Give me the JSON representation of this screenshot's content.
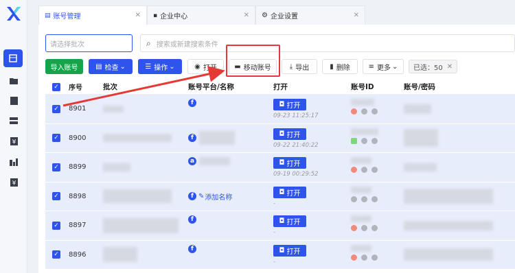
{
  "tabs": [
    {
      "label": "账号管理",
      "icon": "table-icon",
      "active": true
    },
    {
      "label": "企业中心",
      "icon": "briefcase-icon",
      "active": false
    },
    {
      "label": "企业设置",
      "icon": "gear-icon",
      "active": false
    }
  ],
  "filters": {
    "batch_placeholder": "请选择批次",
    "search_placeholder": "搜索或新建搜索条件"
  },
  "toolbar": {
    "import_label": "导入账号",
    "check_label": "检查",
    "operate_label": "操作",
    "open_label": "打开",
    "move_label": "移动账号",
    "export_label": "导出",
    "delete_label": "删除",
    "more_label": "更多",
    "selected_label": "已选：50"
  },
  "table": {
    "headers": [
      "序号",
      "批次",
      "账号平台/名称",
      "打开",
      "账号ID",
      "账号/密码"
    ],
    "rows": [
      {
        "seq": "8901",
        "platform": "facebook",
        "open_label": "打开",
        "open_time": "09-23 11:25:17"
      },
      {
        "seq": "8900",
        "platform": "facebook",
        "open_label": "打开",
        "open_time": "09-22 21:40:22"
      },
      {
        "seq": "8899",
        "platform": "amazon",
        "open_label": "打开",
        "open_time": "09-19 00:29:52"
      },
      {
        "seq": "8898",
        "platform": "facebook",
        "open_label": "打开",
        "open_time": "-",
        "add_name": "添加名称"
      },
      {
        "seq": "8897",
        "platform": "facebook",
        "open_label": "打开",
        "open_time": "-"
      },
      {
        "seq": "8896",
        "platform": "facebook",
        "open_label": "打开",
        "open_time": "-"
      }
    ]
  },
  "colors": {
    "accent": "#2f54eb",
    "green": "#16a34a",
    "highlight": "#e53935",
    "row_bg": "#e8edfc"
  }
}
